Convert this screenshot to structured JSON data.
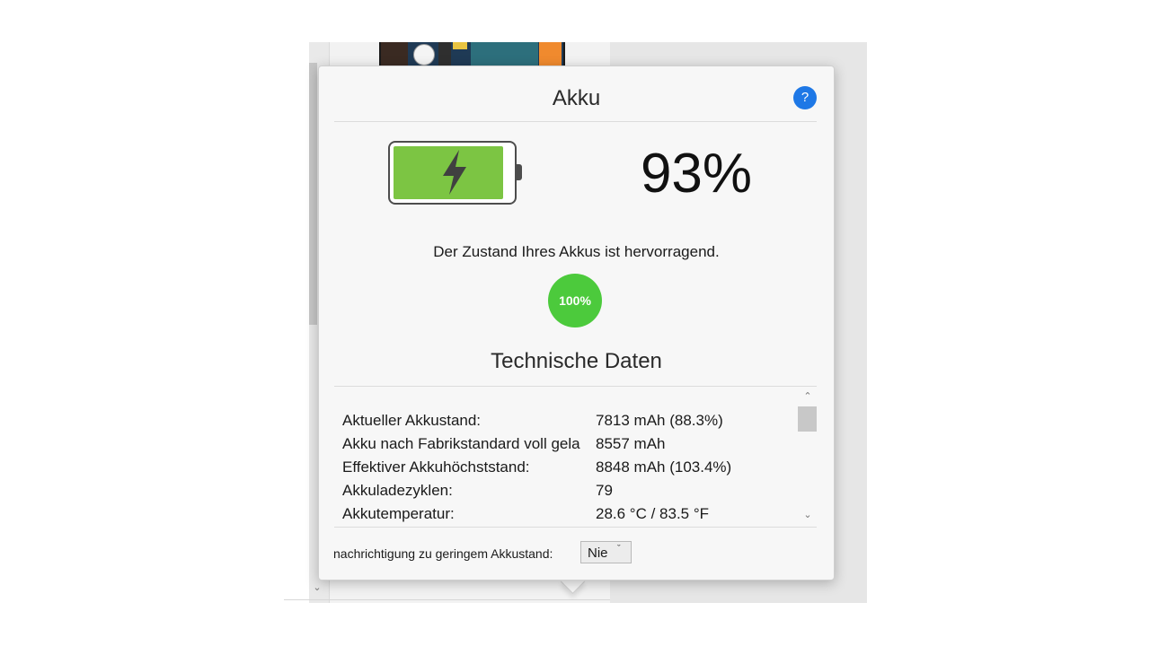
{
  "popover": {
    "title": "Akku",
    "help_label": "?",
    "battery_level": 0.93,
    "battery_percent": "93%",
    "health_text": "Der Zustand Ihres Akkus ist hervorragend.",
    "health_badge": "100%",
    "tech_heading": "Technische Daten"
  },
  "specs": [
    {
      "label": "Aktueller Akkustand:",
      "value": "7813 mAh (88.3%)"
    },
    {
      "label": "Akku nach Fabrikstandard voll gela",
      "value": "8557 mAh"
    },
    {
      "label": "Effektiver Akkuhöchststand:",
      "value": "8848 mAh (103.4%)"
    },
    {
      "label": "Akkuladezyklen:",
      "value": "79"
    },
    {
      "label": "Akkutemperatur:",
      "value": "28.6 °C / 83.5 °F"
    }
  ],
  "footer": {
    "label": "nachrichtigung zu geringem Akkustand:",
    "select_value": "Nie"
  },
  "colors": {
    "battery_fill": "#7cc543",
    "health_badge": "#4cca3c",
    "help_button": "#1e78e6"
  },
  "icons": {
    "help": "question-mark-icon",
    "bolt": "lightning-bolt-icon",
    "scroll_up": "chevron-up-icon",
    "scroll_down": "chevron-down-icon",
    "select_caret": "chevron-down-icon"
  }
}
